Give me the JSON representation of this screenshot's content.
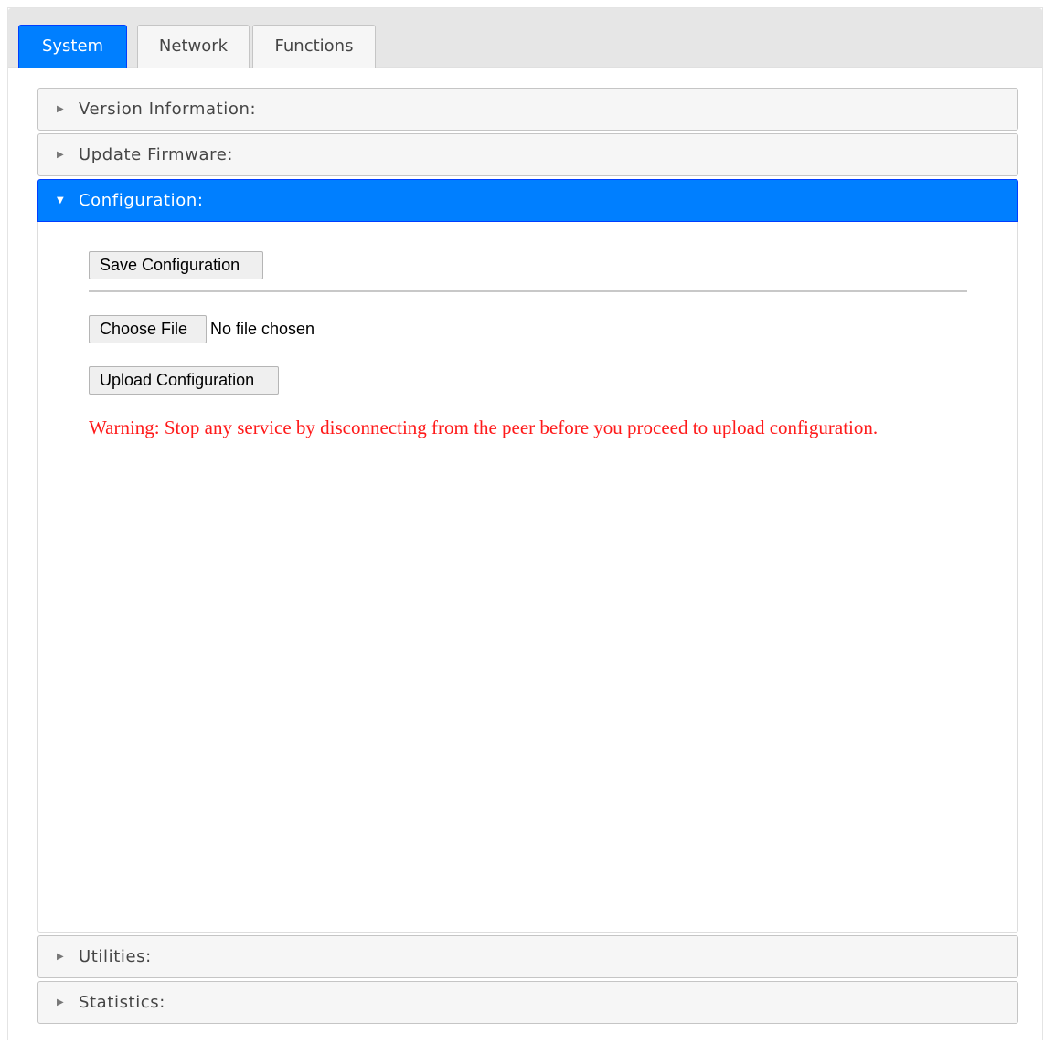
{
  "tabs": [
    {
      "label": "System",
      "active": true
    },
    {
      "label": "Network",
      "active": false
    },
    {
      "label": "Functions",
      "active": false
    }
  ],
  "accordion": {
    "sections": [
      {
        "label": "Version Information:",
        "expanded": false
      },
      {
        "label": "Update Firmware:",
        "expanded": false
      },
      {
        "label": "Configuration:",
        "expanded": true
      },
      {
        "label": "Utilities:",
        "expanded": false
      },
      {
        "label": "Statistics:",
        "expanded": false
      }
    ]
  },
  "configuration": {
    "save_button": "Save Configuration",
    "choose_file_button": "Choose File",
    "file_status": "No file chosen",
    "upload_button": "Upload Configuration",
    "warning": "Warning: Stop any service by disconnecting from the peer before you proceed to upload configuration."
  },
  "colors": {
    "accent": "#007fff",
    "warning": "#ff1a1a"
  },
  "icons": {
    "collapsed": "caret-right-icon",
    "expanded": "caret-down-icon"
  }
}
